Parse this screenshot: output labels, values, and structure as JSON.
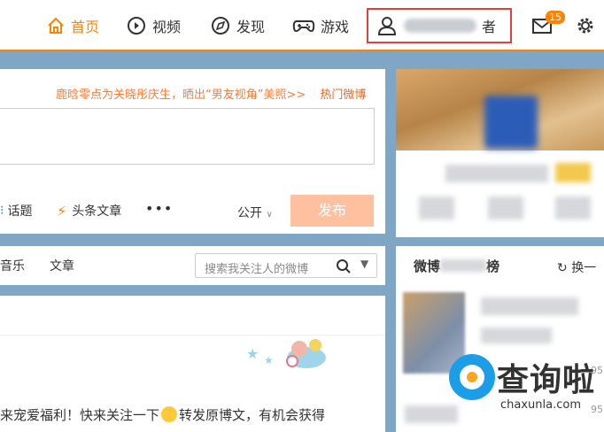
{
  "nav": {
    "home": "首页",
    "video": "视频",
    "discover": "发现",
    "games": "游戏",
    "profile_suffix": "者",
    "message_count": "15"
  },
  "post_box": {
    "hot_topic": "鹿晗零点为关晓彤庆生，晒出“男友视角”美照>>",
    "hot_link": "热门微博",
    "tools": {
      "topic": "话题",
      "article": "头条文章",
      "more": "•••"
    },
    "visibility": "公开",
    "publish": "发布"
  },
  "feed": {
    "tabs": [
      "音乐",
      "文章"
    ],
    "search_placeholder": "搜索我关注人的微博",
    "post_text_before": "来宠爱福利！快来关注一下",
    "post_text_after": "转发原博文，有机会获得"
  },
  "right": {
    "hot_rank_title": "微博",
    "hot_rank_title_tail": "榜",
    "refresh": "换一",
    "rank_nums": [
      "95",
      "95"
    ]
  },
  "watermark": {
    "title": "查询啦",
    "url": "chaxunla.com"
  },
  "colors": {
    "accent": "#ff8200",
    "highlight_box": "#e04040",
    "brand_blue": "#1b9de8"
  }
}
